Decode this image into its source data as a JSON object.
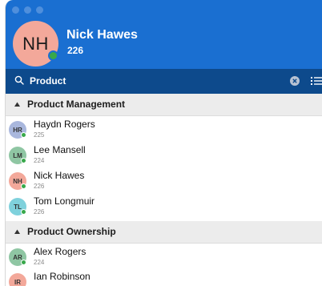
{
  "header": {
    "user": {
      "initials": "NH",
      "name": "Nick Hawes",
      "extension": "226"
    }
  },
  "search": {
    "value": "Product"
  },
  "groups": [
    {
      "title": "Product Management",
      "contacts": [
        {
          "initials": "HR",
          "name": "Haydn Rogers",
          "extension": "225"
        },
        {
          "initials": "LM",
          "name": "Lee Mansell",
          "extension": "224"
        },
        {
          "initials": "NH",
          "name": "Nick Hawes",
          "extension": "226"
        },
        {
          "initials": "TL",
          "name": "Tom Longmuir",
          "extension": "226"
        }
      ]
    },
    {
      "title": "Product Ownership",
      "contacts": [
        {
          "initials": "AR",
          "name": "Alex Rogers",
          "extension": "224"
        },
        {
          "initials": "IR",
          "name": "Ian Robinson",
          "extension": ""
        }
      ]
    }
  ],
  "colors": {
    "header_blue": "#1a6fd1",
    "search_blue": "#0d4a8c",
    "status_green": "#38a84a",
    "avatar_hr": "#a9b7dd",
    "avatar_lm": "#8fc6a3",
    "avatar_nh": "#f3a89a",
    "avatar_tl": "#7fd1dc",
    "avatar_ar": "#8fc6a3",
    "avatar_ir": "#f3a89a"
  }
}
